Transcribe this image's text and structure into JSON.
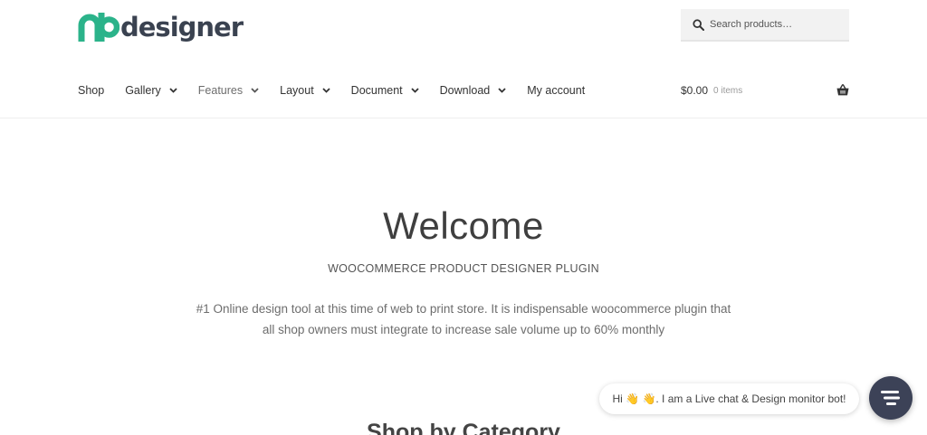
{
  "brand": {
    "logo_text": "designer",
    "logo_mark": "nb",
    "accent_color": "#2bb38a",
    "text_color": "#3a4250"
  },
  "search": {
    "placeholder": "Search products…",
    "icon": "search-icon"
  },
  "nav": {
    "items": [
      {
        "label": "Shop",
        "dropdown": false
      },
      {
        "label": "Gallery",
        "dropdown": true
      },
      {
        "label": "Features",
        "dropdown": true
      },
      {
        "label": "Layout",
        "dropdown": true
      },
      {
        "label": "Document",
        "dropdown": true
      },
      {
        "label": "Download",
        "dropdown": true
      },
      {
        "label": "My account",
        "dropdown": false
      }
    ]
  },
  "cart": {
    "amount": "$0.00",
    "count": "0 items",
    "icon": "basket-icon"
  },
  "hero": {
    "title": "Welcome",
    "subtitle": "WOOCOMMERCE PRODUCT DESIGNER PLUGIN",
    "description": "#1 Online design tool at this time of web to print store. It is indispensable woocommerce plugin that all shop owners must integrate to increase sale volume up to 60% monthly"
  },
  "section": {
    "title": "Shop by Category"
  },
  "chat": {
    "bubble_text": "Hi 👋 👋. I am a Live chat & Design monitor bot!",
    "launcher_icon": "chat-icon",
    "launcher_color": "#3c4257"
  }
}
